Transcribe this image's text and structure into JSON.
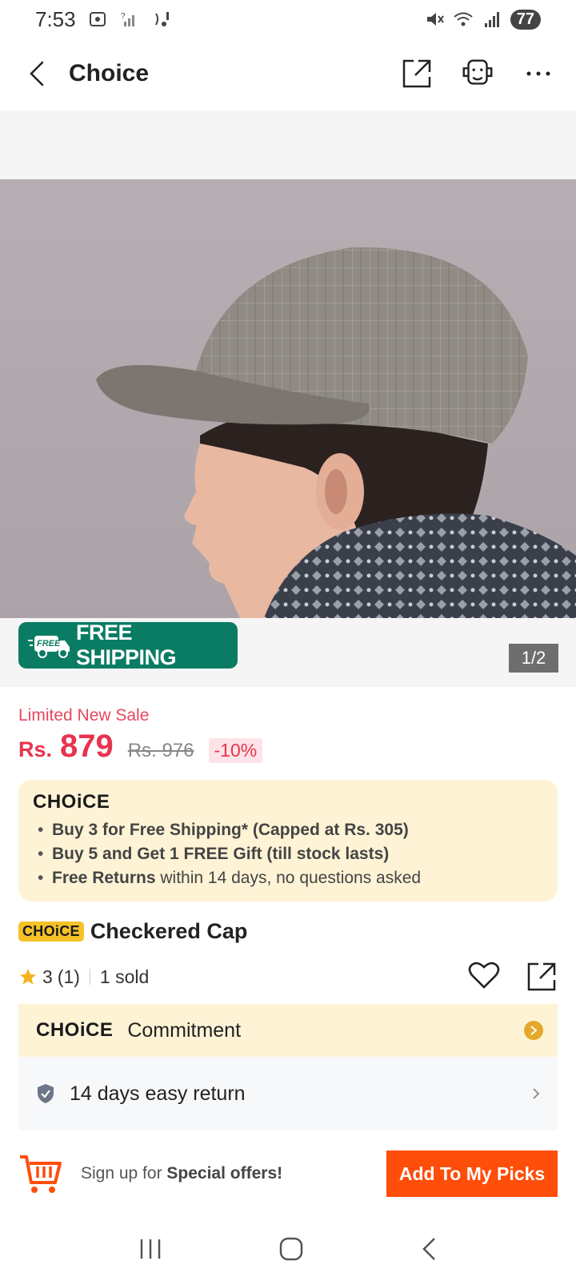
{
  "status_bar": {
    "time": "7:53",
    "battery": "77"
  },
  "header": {
    "title": "Choice"
  },
  "image": {
    "page_indicator": "1/2"
  },
  "badges": {
    "free_icon_text": "FREE",
    "free_shipping": "FREE SHIPPING"
  },
  "price": {
    "sale_label": "Limited New Sale",
    "currency": "Rs.",
    "current": "879",
    "original": "Rs. 976",
    "discount": "-10%"
  },
  "choice_card": {
    "logo": "CHOiCE",
    "benefits": [
      {
        "bold": "Buy 3 for  Free Shipping* (Capped at Rs. 305)",
        "rest": ""
      },
      {
        "bold": "Buy 5 and Get 1 FREE Gift (till stock lasts)",
        "rest": ""
      },
      {
        "bold": "Free Returns",
        "rest": " within 14 days, no questions asked"
      }
    ]
  },
  "product": {
    "badge": "CHOiCE",
    "title": "Checkered Cap",
    "rating": "3",
    "review_count": "(1)",
    "sold": "1 sold"
  },
  "commitment": {
    "logo": "CHOiCE",
    "label": "Commitment",
    "return_text": "14 days easy return"
  },
  "bottom_bar": {
    "signup_prefix": "Sign up for ",
    "signup_bold": "Special offers!",
    "picks_button": "Add To My Picks"
  },
  "colors": {
    "brand_orange": "#ff4d0a",
    "price_red": "#e8334f",
    "shipping_green": "#0a7c64",
    "choice_yellow": "#fff3d6"
  }
}
